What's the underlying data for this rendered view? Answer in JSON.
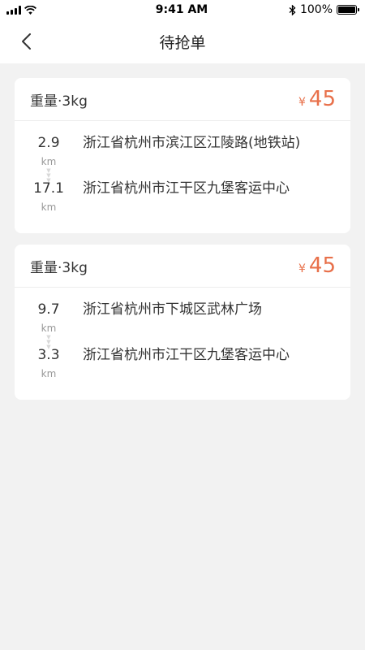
{
  "status_bar": {
    "time": "9:41 AM",
    "battery": "100%",
    "battery_level": 1.0,
    "icons": [
      "signal-icon",
      "wifi-icon",
      "bluetooth-icon",
      "battery-icon"
    ]
  },
  "nav": {
    "title": "待抢单",
    "back_icon": "chevron-left-icon"
  },
  "orders": [
    {
      "weight": "重量·3kg",
      "currency": "¥",
      "price": "45",
      "pickup": {
        "distance": "2.9",
        "unit": "km",
        "address": "浙江省杭州市滨江区江陵路(地铁站)"
      },
      "dropoff": {
        "distance": "17.1",
        "unit": "km",
        "address": "浙江省杭州市江干区九堡客运中心"
      }
    },
    {
      "weight": "重量·3kg",
      "currency": "¥",
      "price": "45",
      "pickup": {
        "distance": "9.7",
        "unit": "km",
        "address": "浙江省杭州市下城区武林广场"
      },
      "dropoff": {
        "distance": "3.3",
        "unit": "km",
        "address": "浙江省杭州市江干区九堡客运中心"
      }
    }
  ],
  "colors": {
    "accent": "#e8704a",
    "background": "#f2f2f2",
    "card": "#ffffff",
    "text": "#333333",
    "muted": "#999999"
  }
}
